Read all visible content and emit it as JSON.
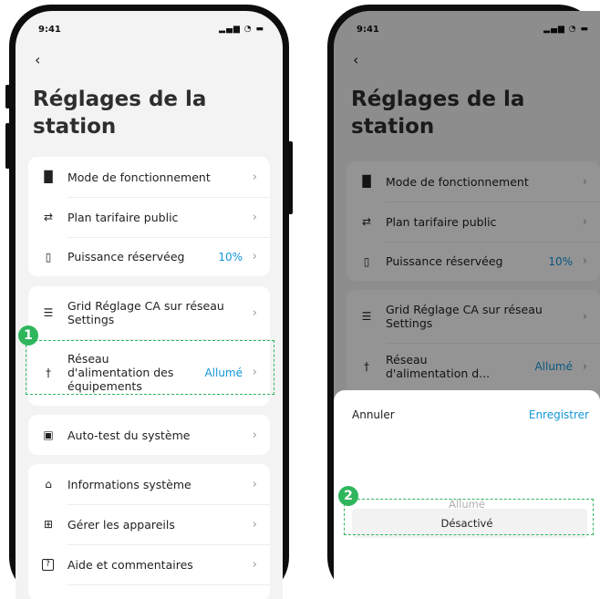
{
  "status": {
    "time": "9:41",
    "icons": "▂▄▆ ◔ ▬"
  },
  "page": {
    "back": "‹",
    "title": "Réglages de la station"
  },
  "group1": [
    {
      "icon": "building-icon",
      "glyph": "█",
      "label": "Mode de fonctionnement",
      "value": ""
    },
    {
      "icon": "tariff-icon",
      "glyph": "⇄",
      "label": "Plan tarifaire public",
      "value": ""
    },
    {
      "icon": "battery-icon",
      "glyph": "▯",
      "label": "Puissance réservéeg",
      "value": "10%"
    }
  ],
  "group2": [
    {
      "icon": "grid-settings-icon",
      "glyph": "☰",
      "label": "Grid Réglage CA sur réseau Settings",
      "value": ""
    },
    {
      "icon": "power-tower-icon",
      "glyph": "†",
      "label": "Réseau d'alimentation des équipements",
      "value": "Allumé"
    }
  ],
  "group3": [
    {
      "icon": "selftest-icon",
      "glyph": "▣",
      "label": "Auto-test du système",
      "value": ""
    }
  ],
  "group4": [
    {
      "icon": "system-info-icon",
      "glyph": "⌂",
      "label": "Informations système",
      "value": ""
    },
    {
      "icon": "devices-icon",
      "glyph": "⊞",
      "label": "Gérer les appareils",
      "value": ""
    },
    {
      "icon": "help-icon",
      "glyph": "?",
      "label": "Aide et commentaires",
      "value": ""
    }
  ],
  "right": {
    "group2_short": "Réseau d'alimentation d...",
    "sheet": {
      "cancel": "Annuler",
      "save": "Enregistrer",
      "options": [
        "Allumé",
        "Désactivé"
      ]
    }
  },
  "callouts": [
    "1",
    "2"
  ],
  "colors": {
    "accent": "#1296db",
    "callout": "#2fb65d"
  }
}
